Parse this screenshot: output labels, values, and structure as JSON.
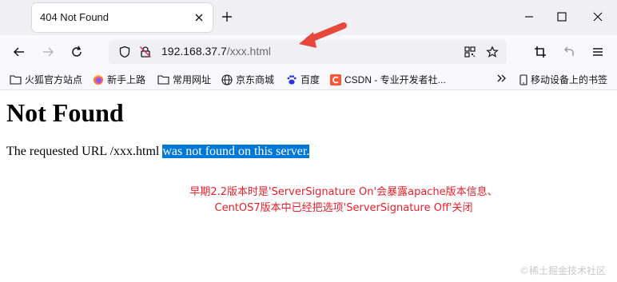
{
  "tab": {
    "title": "404 Not Found"
  },
  "address": {
    "host": "192.168.37.7",
    "path": "/xxx.html"
  },
  "bookmarks": {
    "items": [
      {
        "label": "火狐官方站点",
        "icon": "folder-icon"
      },
      {
        "label": "新手上路",
        "icon": "firefox-icon"
      },
      {
        "label": "常用网址",
        "icon": "folder-icon"
      },
      {
        "label": "京东商城",
        "icon": "globe-icon"
      },
      {
        "label": "百度",
        "icon": "baidu-icon"
      },
      {
        "label": "CSDN - 专业开发者社...",
        "icon": "csdn-icon"
      }
    ],
    "mobile_label": "移动设备上的书签"
  },
  "page": {
    "heading": "Not Found",
    "message_plain": "The requested URL /xxx.html ",
    "message_selected": "was not found on this server."
  },
  "annotation": {
    "line1": "早期2.2版本时是'ServerSignature On'会暴露apache版本信息、",
    "line2": "CentOS7版本中已经把选项'ServerSignature Off'关闭",
    "color": "#e8202a"
  },
  "watermark": "©稀土掘金技术社区",
  "colors": {
    "selection": "#0078d7",
    "arrow": "#e8473b"
  }
}
